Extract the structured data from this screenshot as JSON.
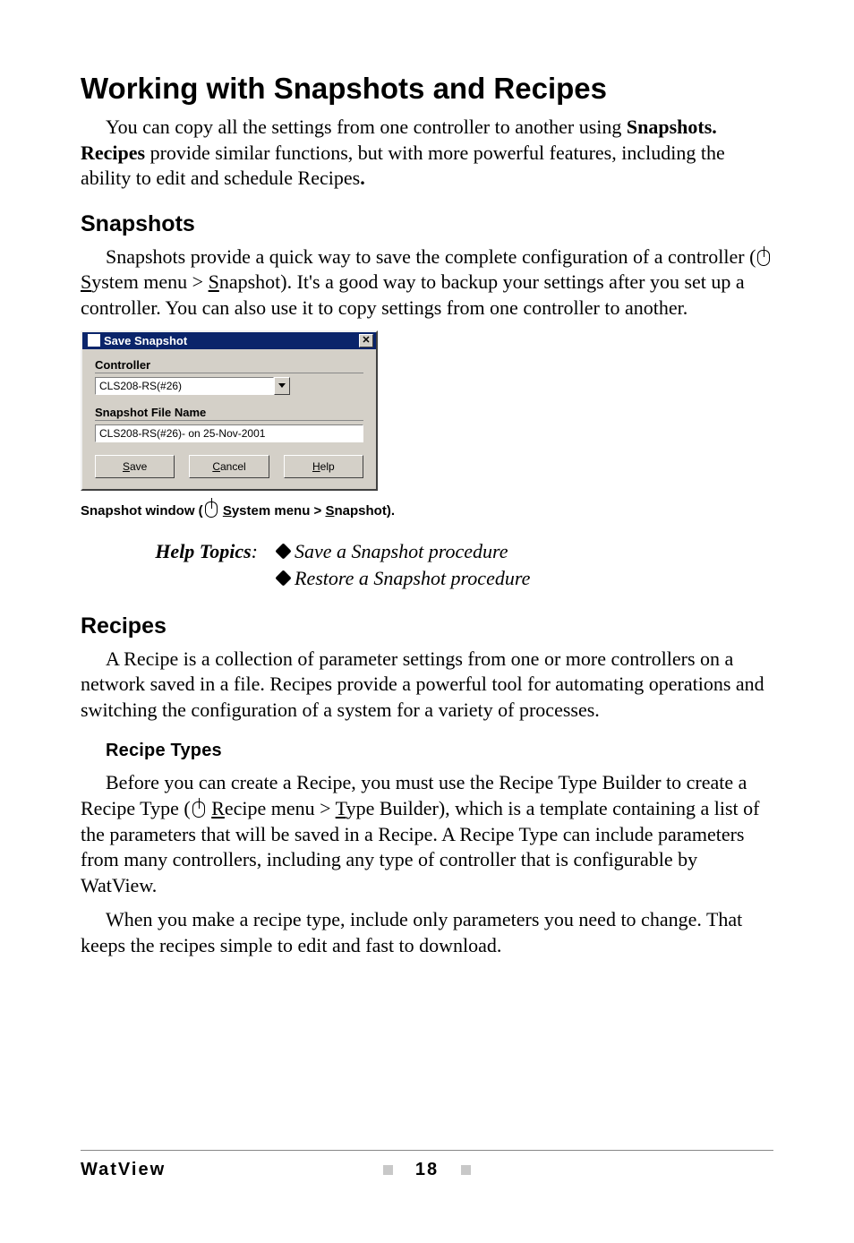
{
  "h1": "Working with Snapshots and Recipes",
  "intro": {
    "p1_pre": "You can copy all the settings from one controller to another using ",
    "p1_b1": "Snapshots. Recipes",
    "p1_mid": " provide similar functions, but with more powerful features, including the ability to edit and schedule Recipes",
    "p1_b2": "."
  },
  "snapshots": {
    "heading": "Snapshots",
    "p_pre": "Snapshots provide a quick way to save the complete configuration of a controller (",
    "menu1_u": "S",
    "menu1_rest": "ystem menu > ",
    "menu2_u": "S",
    "menu2_rest": "napshot). It's a good way to backup your settings after you set up a controller. You can also use it to copy settings from one controller to another."
  },
  "dialog": {
    "title": "Save Snapshot",
    "controller_label": "Controller",
    "controller_value": "CLS208-RS(#26)",
    "file_label": "Snapshot File Name",
    "file_value": "CLS208-RS(#26)- on 25-Nov-2001",
    "save_u": "S",
    "save_rest": "ave",
    "cancel_u": "C",
    "cancel_rest": "ancel",
    "help_u": "H",
    "help_rest": "elp"
  },
  "caption": {
    "pre": "Snapshot window (",
    "menu1_u": "S",
    "menu1_rest": "ystem menu > ",
    "menu2_u": "S",
    "menu2_rest": "napshot)."
  },
  "help": {
    "label": "Help Topics",
    "label_colon": ":",
    "items": [
      "Save a Snapshot procedure",
      "Restore a Snapshot procedure"
    ]
  },
  "recipes": {
    "heading": "Recipes",
    "p1": "A Recipe is a collection of parameter settings from one or more controllers on a network saved in a file. Recipes provide a powerful tool for automating operations and switching the configuration of a system for a variety of processes.",
    "sub": "Recipe Types",
    "p2_pre": "Before you can create a Recipe, you must use the Recipe Type Builder to create a Recipe Type (",
    "p2_m1_u": "R",
    "p2_m1_rest": "ecipe menu > ",
    "p2_m2_u": "T",
    "p2_m2_rest": "ype Builder), which is a template containing a list of the parameters that will be saved in a Recipe. A Recipe Type can include parameters from many controllers, including any type of controller that is configurable by WatView.",
    "p3": "When you make a recipe type, include only parameters you need to change. That keeps the recipes simple to edit and fast to download."
  },
  "footer": {
    "product": "WatView",
    "page": "18"
  }
}
